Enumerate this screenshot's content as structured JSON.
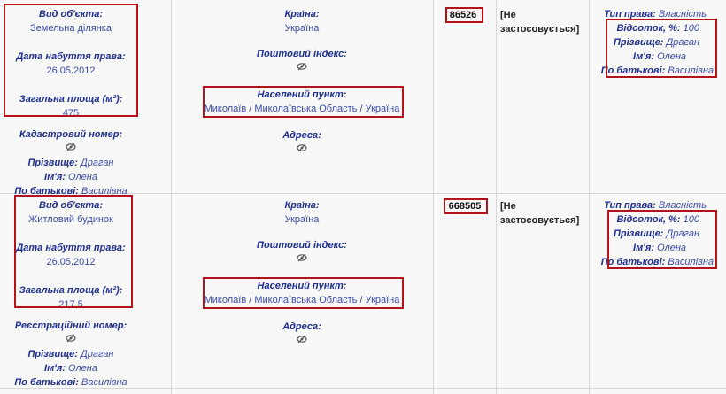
{
  "records": [
    {
      "object": {
        "type_label": "Вид об'єкта:",
        "type_value": "Земельна ділянка",
        "date_label": "Дата набуття права:",
        "date_value": "26.05.2012",
        "area_label": "Загальна площа (м²):",
        "area_value": "475",
        "extra_label": "Кадастровий номер:",
        "surname_label": "Прізвище:",
        "surname_value": "Драган",
        "name_label": "Ім'я:",
        "name_value": "Олена",
        "patronymic_label": "По батькові:",
        "patronymic_value": "Василівна"
      },
      "address": {
        "country_label": "Країна:",
        "country_value": "Україна",
        "postal_label": "Поштовий індекс:",
        "locality_label": "Населений пункт:",
        "locality_value": "Миколаїв / Миколаївська Область / Україна",
        "addr_label": "Адреса:"
      },
      "value": "86526",
      "status": "[Не застосовується]",
      "rights": {
        "type_label": "Тип права:",
        "type_value": "Власність",
        "percent_label": "Відсоток, %:",
        "percent_value": "100",
        "surname_label": "Прізвище:",
        "surname_value": "Драган",
        "name_label": "Ім'я:",
        "name_value": "Олена",
        "patronymic_label": "По батькові:",
        "patronymic_value": "Василівна"
      }
    },
    {
      "object": {
        "type_label": "Вид об'єкта:",
        "type_value": "Житловий будинок",
        "date_label": "Дата набуття права:",
        "date_value": "26.05.2012",
        "area_label": "Загальна площа (м²):",
        "area_value": "217,5",
        "extra_label": "Реєстраційний номер:",
        "surname_label": "Прізвище:",
        "surname_value": "Драган",
        "name_label": "Ім'я:",
        "name_value": "Олена",
        "patronymic_label": "По батькові:",
        "patronymic_value": "Василівна"
      },
      "address": {
        "country_label": "Країна:",
        "country_value": "Україна",
        "postal_label": "Поштовий індекс:",
        "locality_label": "Населений пункт:",
        "locality_value": "Миколаїв / Миколаївська Область / Україна",
        "addr_label": "Адреса:"
      },
      "value": "668505",
      "status": "[Не застосовується]",
      "rights": {
        "type_label": "Тип права:",
        "type_value": "Власність",
        "percent_label": "Відсоток, %:",
        "percent_value": "100",
        "surname_label": "Прізвище:",
        "surname_value": "Драган",
        "name_label": "Ім'я:",
        "name_value": "Олена",
        "patronymic_label": "По батькові:",
        "patronymic_value": "Василівна"
      }
    }
  ],
  "icons": {
    "hidden": "eye-slash-icon"
  },
  "colors": {
    "highlight": "#b3141c",
    "label": "#1d2f8f",
    "value": "#3a4aa8"
  }
}
